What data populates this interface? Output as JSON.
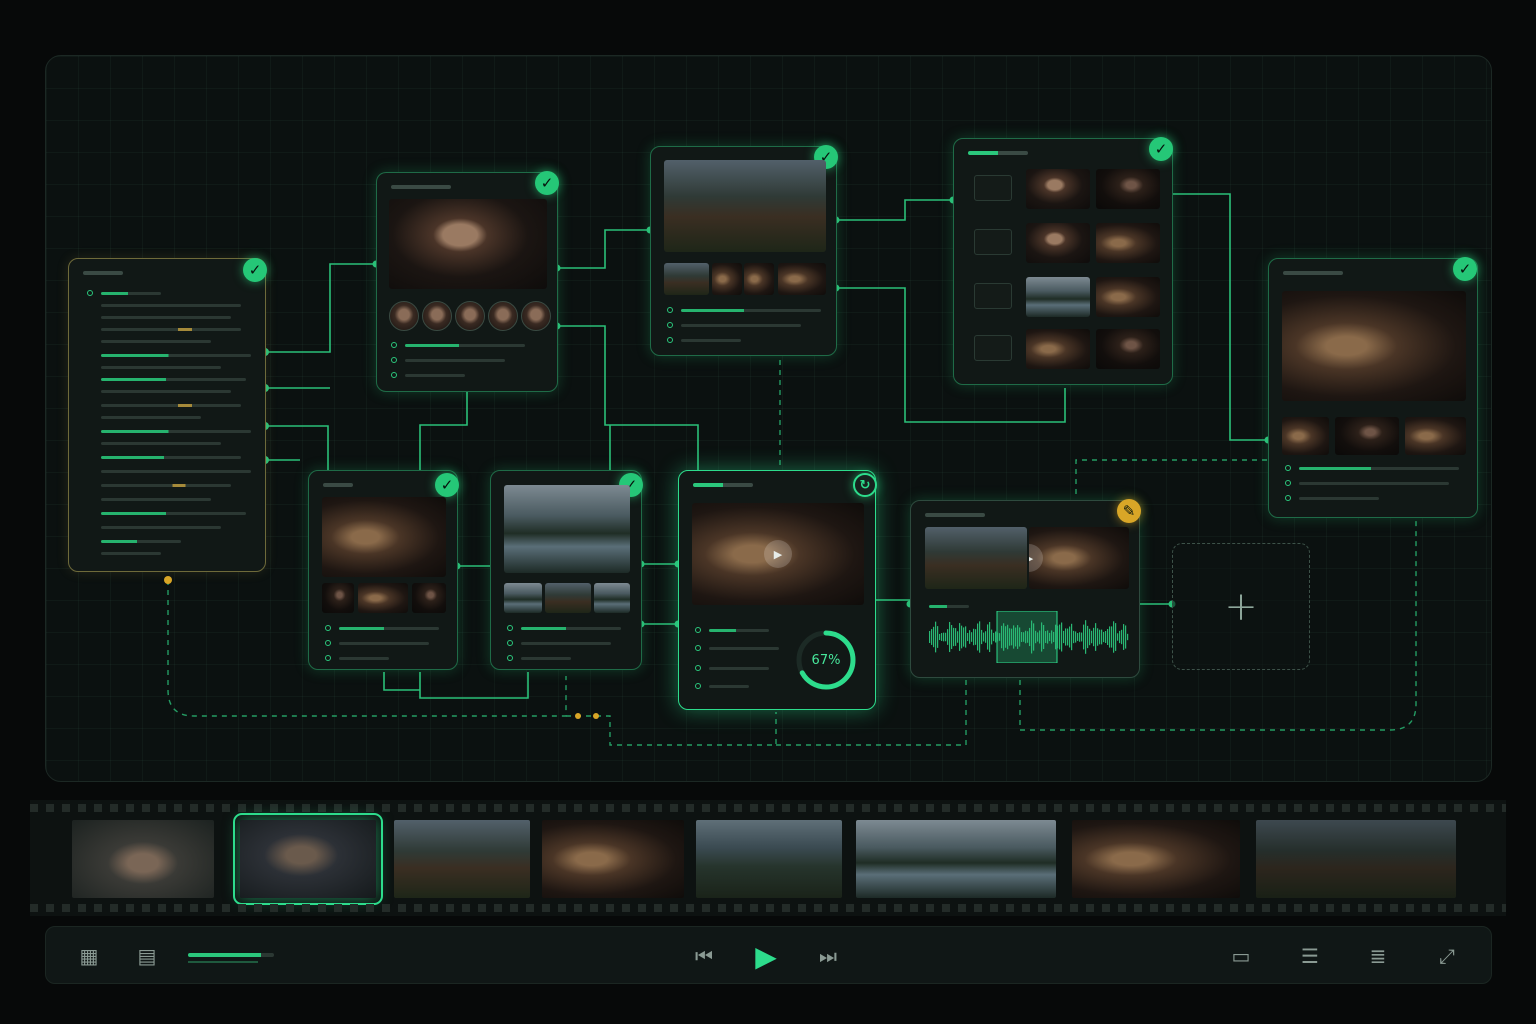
{
  "progress": {
    "text": "67%",
    "value": 0.67
  },
  "colors": {
    "accent": "#2ddc8c",
    "success": "#25c777",
    "warning": "#d9a627",
    "background": "#070909"
  },
  "icons": {
    "check": "✓",
    "warn": "✎",
    "spin": "↻",
    "play_overlay": "▶",
    "add": "+",
    "grid": "▦",
    "layout": "▤",
    "skip_back": "⏮",
    "play": "▶",
    "skip_forward": "⏭",
    "timeline": "▭",
    "list_view": "☰",
    "list_alt": "≣",
    "expand": "⤢"
  },
  "toolbar": {
    "slider_value": 0.85
  }
}
